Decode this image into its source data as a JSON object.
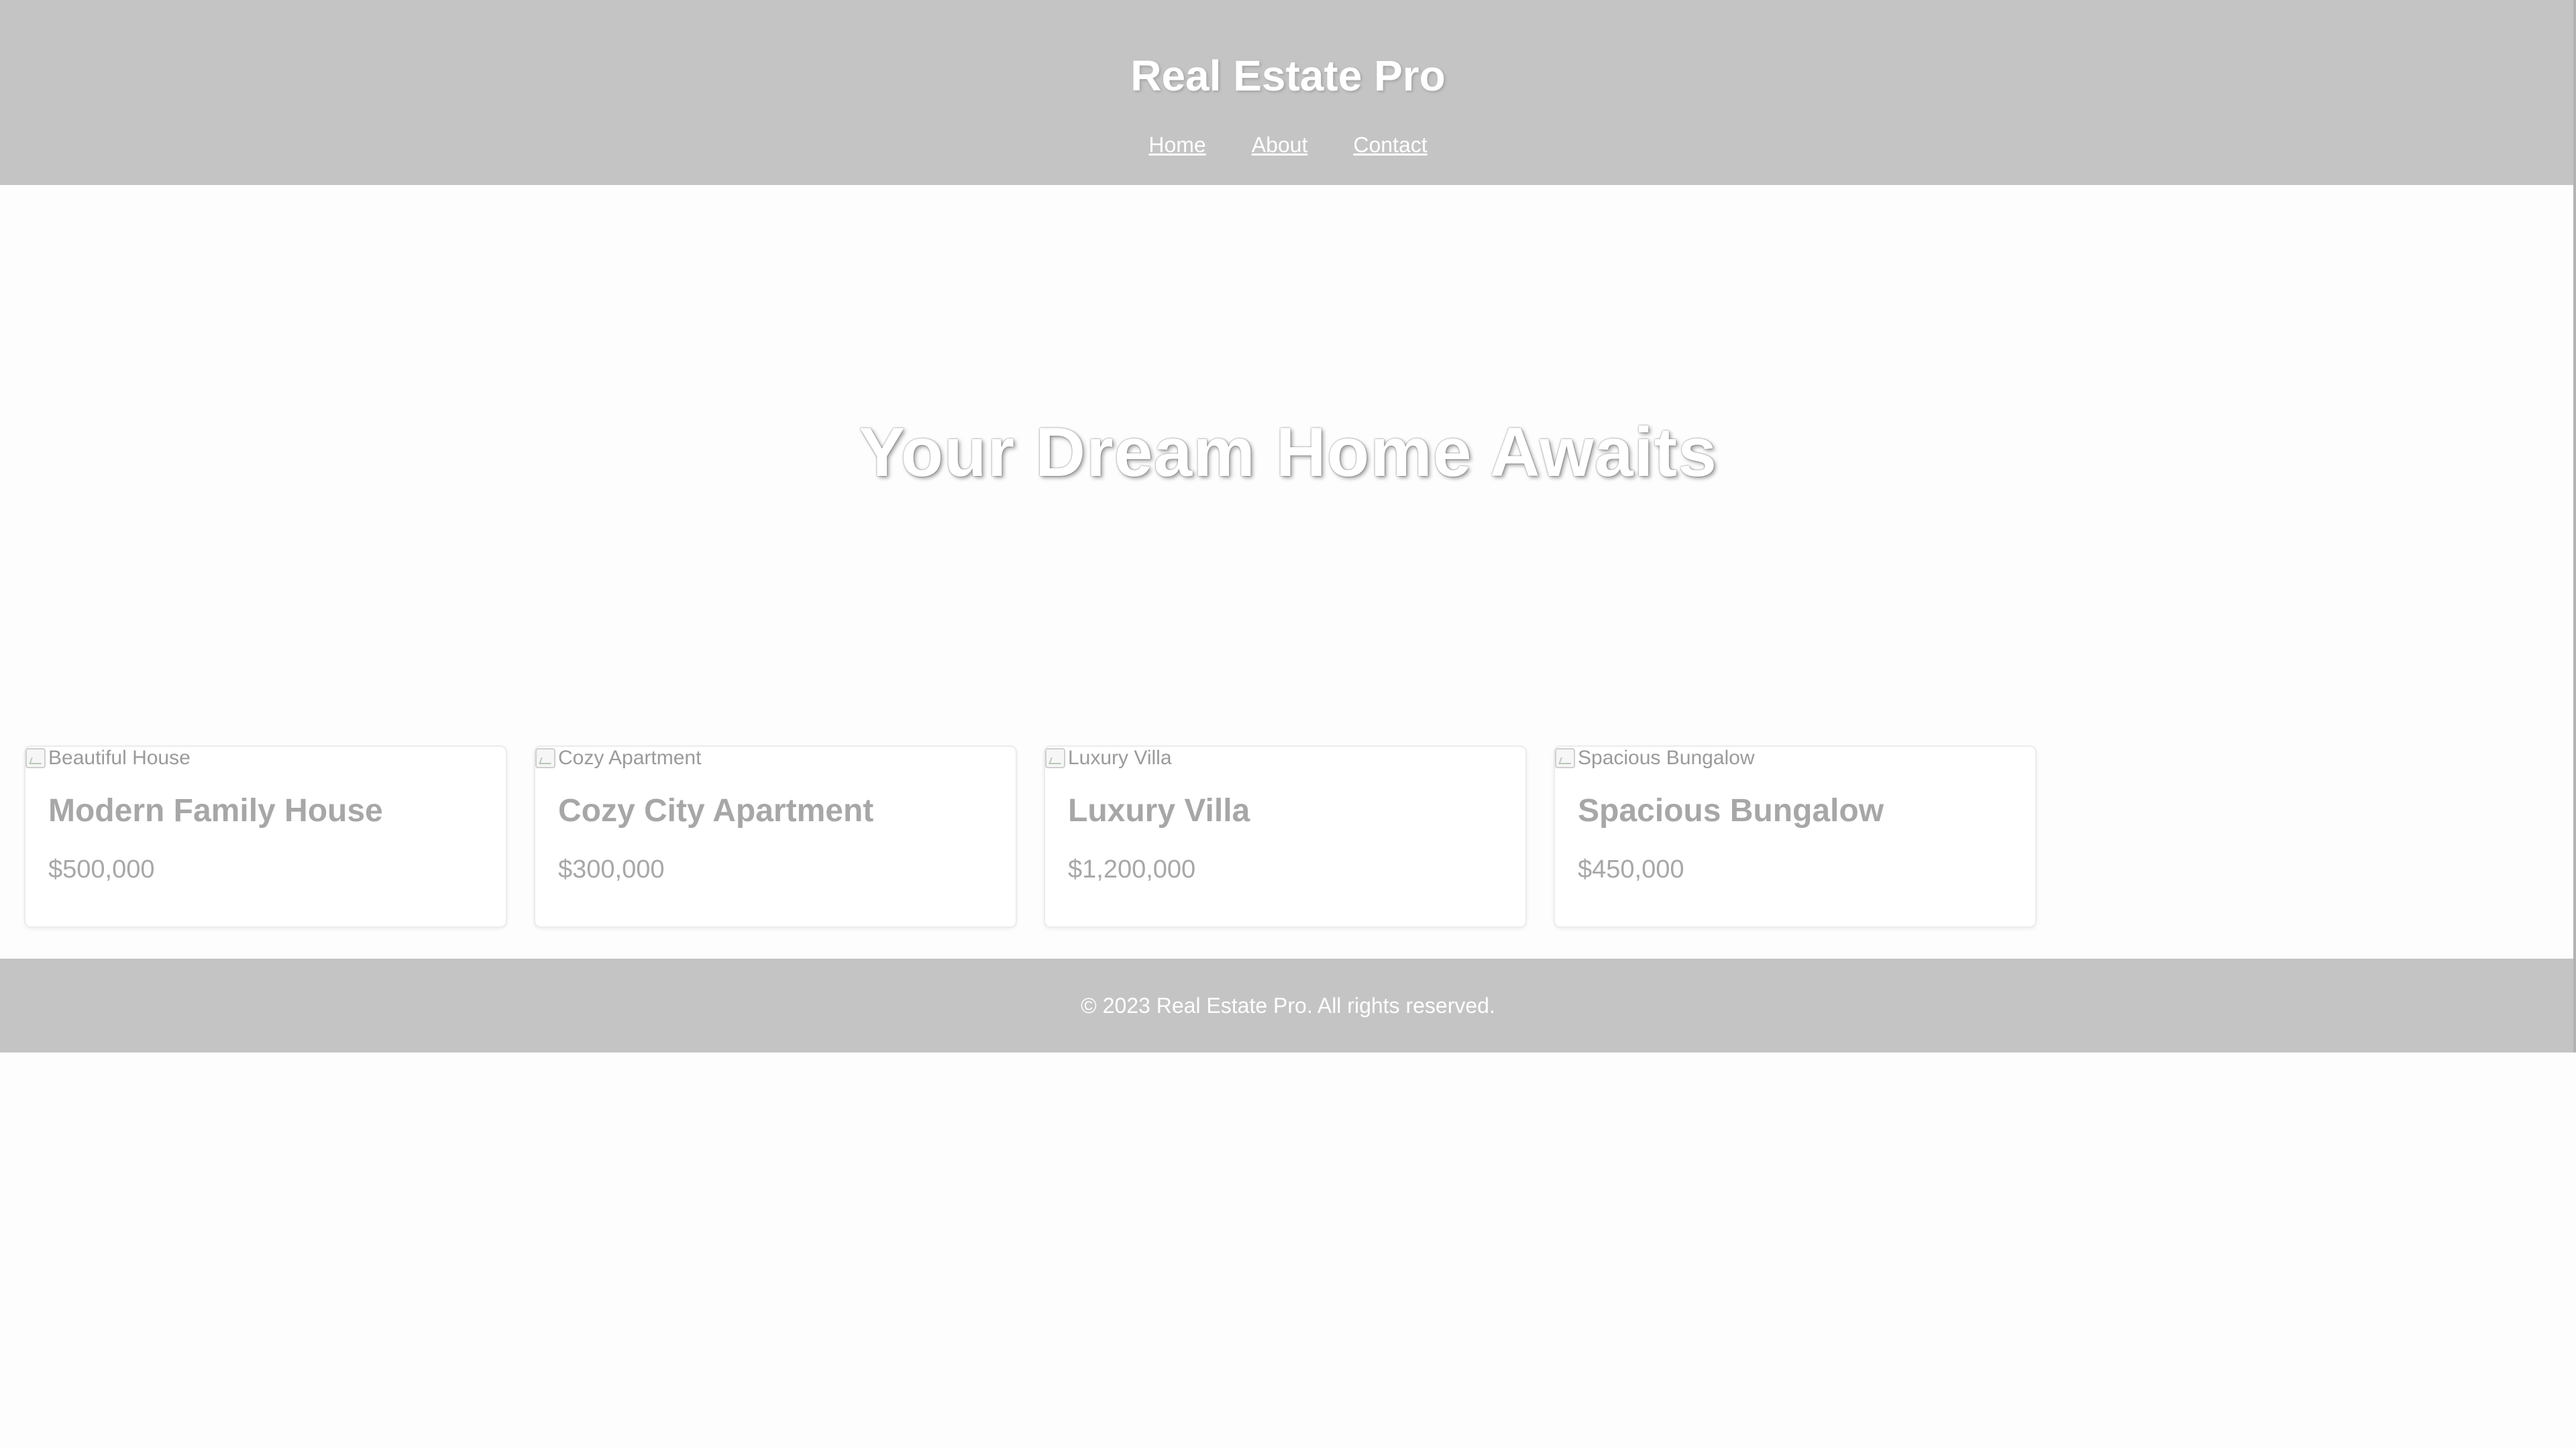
{
  "header": {
    "title": "Real Estate Pro",
    "nav": [
      {
        "label": "Home"
      },
      {
        "label": "About"
      },
      {
        "label": "Contact"
      }
    ]
  },
  "hero": {
    "headline": "Your Dream Home Awaits"
  },
  "listings": [
    {
      "image_alt": "Beautiful House",
      "title": "Modern Family House",
      "price": "$500,000"
    },
    {
      "image_alt": "Cozy Apartment",
      "title": "Cozy City Apartment",
      "price": "$300,000"
    },
    {
      "image_alt": "Luxury Villa",
      "title": "Luxury Villa",
      "price": "$1,200,000"
    },
    {
      "image_alt": "Spacious Bungalow",
      "title": "Spacious Bungalow",
      "price": "$450,000"
    }
  ],
  "footer": {
    "text": "© 2023 Real Estate Pro. All rights reserved."
  },
  "colors": {
    "header_bg": "#c4c4c4",
    "page_bg": "#fdfdfd",
    "card_text": "#a7a7a7"
  },
  "icons": {
    "listing_image": "broken-image-icon"
  }
}
